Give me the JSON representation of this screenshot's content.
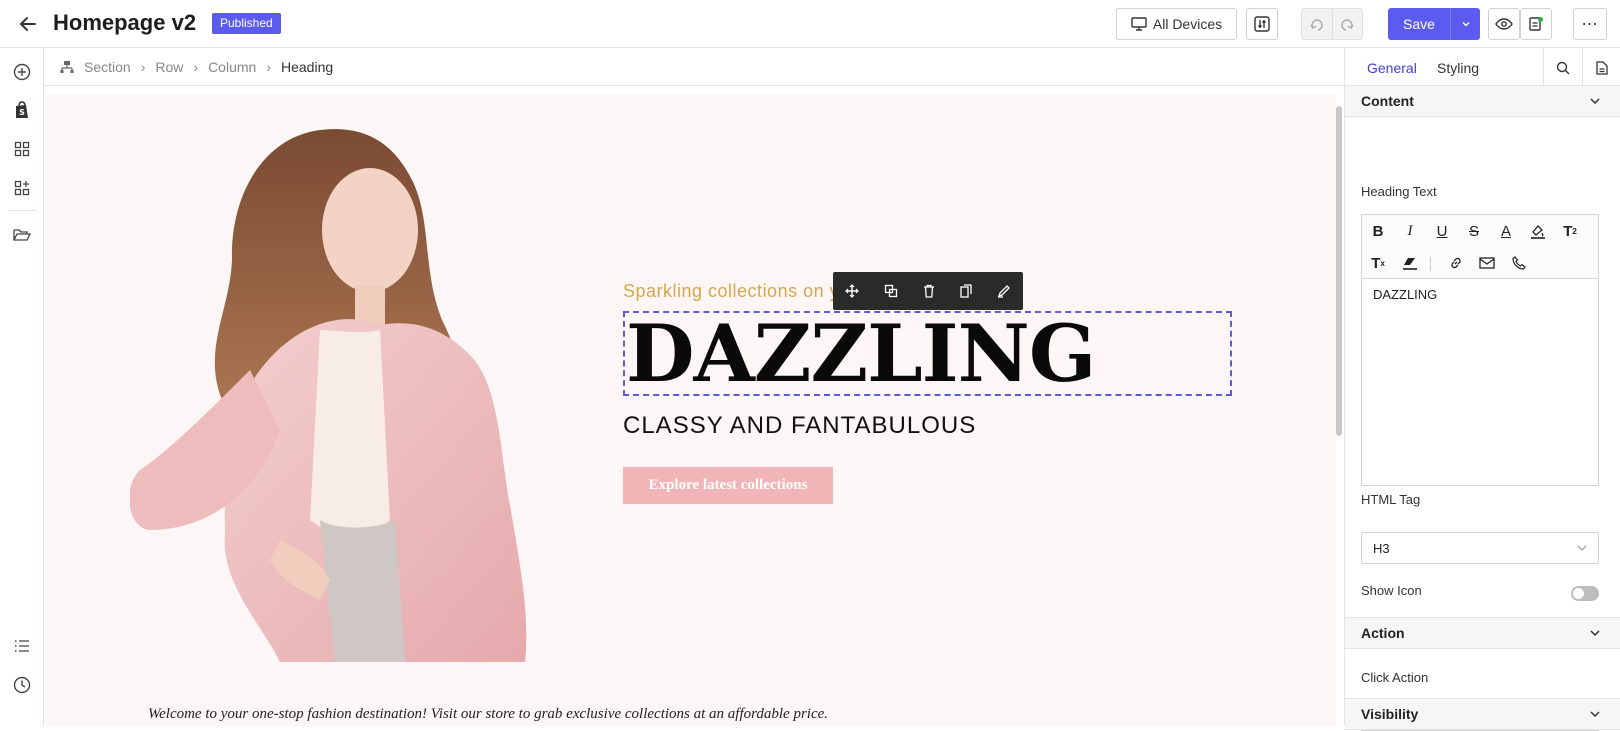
{
  "header": {
    "title": "Homepage v2",
    "status_badge": "Published",
    "devices_label": "All Devices",
    "save_label": "Save"
  },
  "breadcrumb": {
    "items": [
      "Section",
      "Row",
      "Column",
      "Heading"
    ]
  },
  "canvas": {
    "subtitle": "Sparkling collections on y",
    "heading": "DAZZLING",
    "tagline": "CLASSY AND FANTABULOUS",
    "cta_label": "Explore latest collections",
    "welcome_text": "Welcome to your one-stop fashion destination! Visit our store to grab exclusive collections at an affordable price."
  },
  "panel": {
    "tabs": [
      "General",
      "Styling"
    ],
    "content_section": "Content",
    "heading_text_label": "Heading Text",
    "editor_value": "DAZZLING",
    "html_tag_label": "HTML Tag",
    "html_tag_value": "H3",
    "show_icon_label": "Show Icon",
    "show_icon_on": false,
    "action_section": "Action",
    "click_action_label": "Click Action",
    "visibility_section": "Visibility"
  },
  "colors": {
    "accent": "#5b5bf0",
    "hero_bg": "#fcf6f6",
    "subtitle": "#d9a64a",
    "cta_bg": "#f1b5b8"
  },
  "icons": {
    "rail": [
      "plus-circle-icon",
      "shopify-icon",
      "grid-icon",
      "apps-add-icon",
      "folder-open-icon",
      "list-icon",
      "history-icon"
    ],
    "floating_toolbar": [
      "move-icon",
      "copy-icon",
      "delete-icon",
      "duplicate-icon",
      "paint-icon"
    ],
    "editor_toolbar": [
      "bold-icon",
      "italic-icon",
      "underline-icon",
      "strikethrough-icon",
      "font-color-icon",
      "highlight-icon",
      "superscript-icon",
      "subscript-icon",
      "eraser-icon",
      "link-icon",
      "email-icon",
      "phone-icon"
    ],
    "click_actions": [
      "link-icon",
      "popup-icon",
      "email-icon",
      "phone-icon",
      "none-icon"
    ]
  }
}
